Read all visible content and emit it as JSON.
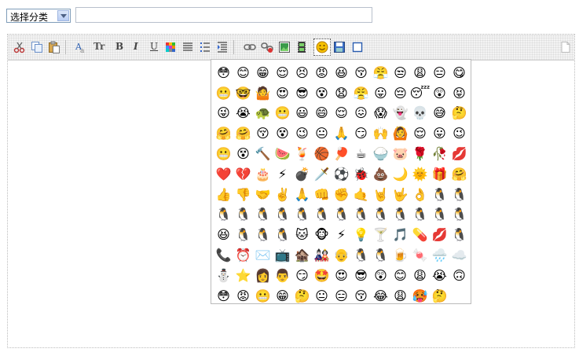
{
  "category_select": {
    "selected": "选择分类"
  },
  "title_input": {
    "value": "",
    "placeholder": ""
  },
  "toolbar": {
    "buttons": [
      {
        "name": "cut-button",
        "icon": "scissors-icon"
      },
      {
        "name": "copy-button",
        "icon": "copy-icon"
      },
      {
        "name": "paste-button",
        "icon": "paste-icon"
      },
      {
        "name": "font-button",
        "icon": "font-icon"
      },
      {
        "name": "font-size-button",
        "icon": "font-size-icon",
        "text": "Tr"
      },
      {
        "name": "bold-button",
        "icon": "bold-icon",
        "text": "B"
      },
      {
        "name": "italic-button",
        "icon": "italic-icon",
        "text": "I"
      },
      {
        "name": "underline-button",
        "icon": "underline-icon",
        "text": "U"
      },
      {
        "name": "color-button",
        "icon": "color-palette-icon"
      },
      {
        "name": "align-button",
        "icon": "align-justify-icon"
      },
      {
        "name": "list-button",
        "icon": "bullet-list-icon"
      },
      {
        "name": "indent-button",
        "icon": "indent-icon"
      },
      {
        "name": "link-button",
        "icon": "link-icon"
      },
      {
        "name": "unlink-button",
        "icon": "unlink-icon"
      },
      {
        "name": "image-button",
        "icon": "image-icon"
      },
      {
        "name": "media-button",
        "icon": "film-icon"
      },
      {
        "name": "emoticon-button",
        "icon": "smiley-icon",
        "active": true
      },
      {
        "name": "save-button",
        "icon": "save-icon"
      },
      {
        "name": "fullscreen-button",
        "icon": "square-icon"
      },
      {
        "name": "source-button",
        "icon": "document-icon"
      }
    ]
  },
  "emoticons": [
    "😳",
    "😊",
    "😁",
    "😌",
    "😣",
    "😡",
    "😆",
    "😚",
    "😤",
    "😒",
    "😩",
    "😑",
    "😋",
    "😬",
    "🤓",
    "🤷",
    "😍",
    "😎",
    "😵",
    "😧",
    "😤",
    "😛",
    "😔",
    "😴",
    "😲",
    "😝",
    "😜",
    "😭",
    "🐢",
    "😬",
    "😃",
    "😄",
    "😌",
    "😖",
    "😱",
    "👻",
    "💀",
    "😅",
    "🤔",
    "🤗",
    "🤗",
    "😚",
    "😵",
    "😉",
    "😐",
    "🙏",
    "😏",
    "🙌",
    "🙆",
    "😌",
    "😛",
    "😉",
    "😬",
    "😵",
    "🔨",
    "🍉",
    "🍹",
    "🏀",
    "🏓",
    "☕",
    "🍚",
    "🐷",
    "🌹",
    "🥀",
    "💋",
    "❤️",
    "💔",
    "🎂",
    "⚡",
    "💣",
    "🗡️",
    "⚽",
    "🐞",
    "💩",
    "🌙",
    "🌞",
    "🎁",
    "🤗",
    "👍",
    "👎",
    "🤝",
    "✌️",
    "🙏",
    "👊",
    "✊",
    "🤙",
    "🤘",
    "🤟",
    "👌",
    "🐧",
    "🐧",
    "🐧",
    "🐧",
    "🐧",
    "🐧",
    "🐧",
    "🐧",
    "🐧",
    "🐧",
    "🐧",
    "🐧",
    "🐧",
    "🐧",
    "🐧",
    "😆",
    "🐧",
    "🐧",
    "🐧",
    "🐱",
    "🐵",
    "⚡",
    "💡",
    "🍸",
    "🎵",
    "💊",
    "💋",
    "🐧",
    "📞",
    "⏰",
    "✉️",
    "📺",
    "🏚️",
    "🎎",
    "👴",
    "🐧",
    "🐧",
    "🍺",
    "🍬",
    "🌧️",
    "☁️",
    "⛄",
    "⭐",
    "👩",
    "👨",
    "😏",
    "🤩",
    "😍",
    "😎",
    "😲",
    "😊",
    "😩",
    "😭",
    "🙃",
    "😳",
    "😡",
    "😬",
    "😁",
    "🤔",
    "😐",
    "😑",
    "😚",
    "😂",
    "😩",
    "🥵",
    "🤔",
    ""
  ]
}
